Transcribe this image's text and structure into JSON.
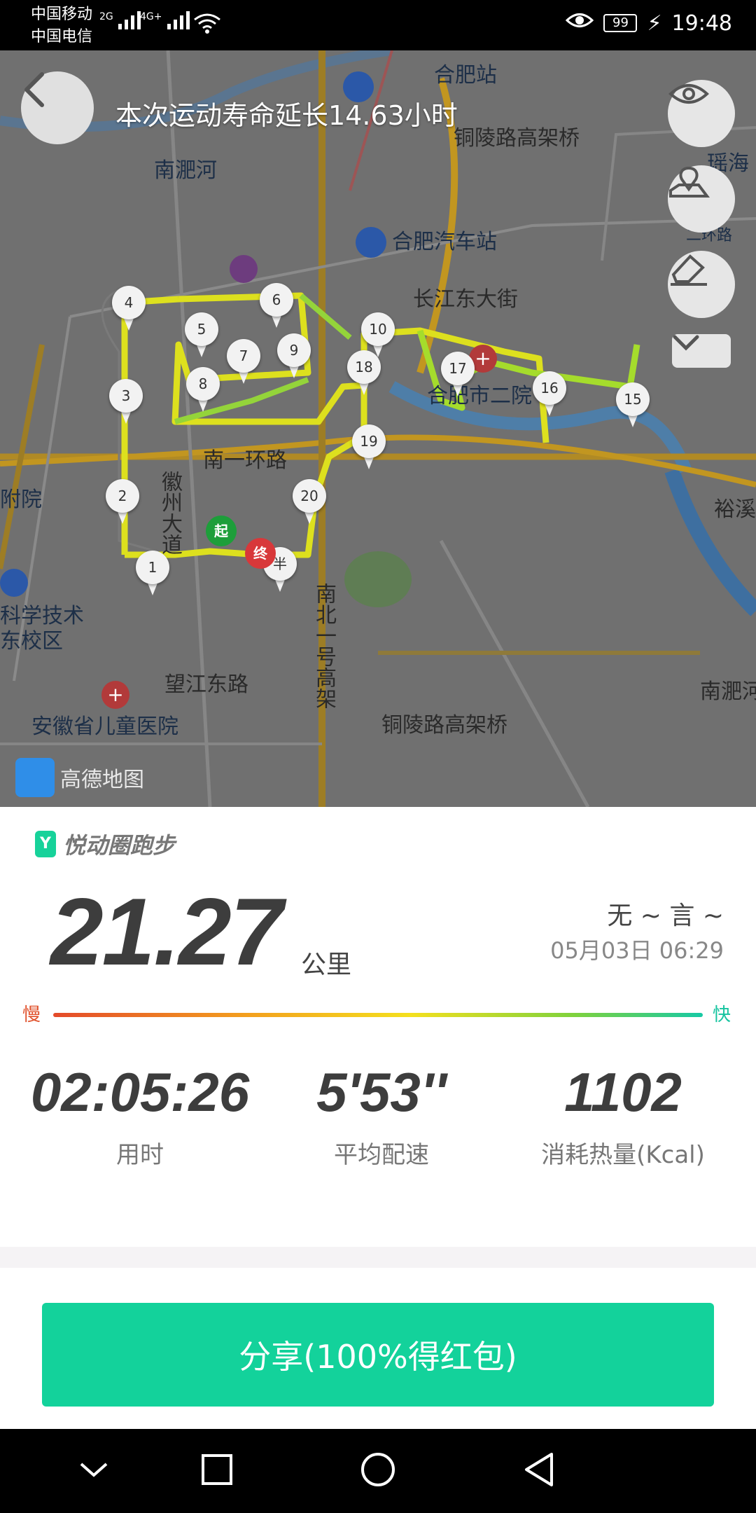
{
  "status_bar": {
    "carrier1": "中国移动",
    "carrier2": "中国电信",
    "net1": "2G",
    "net2": "4G+",
    "battery": "99",
    "time": "19:48"
  },
  "map": {
    "longevity_text": "本次运动寿命延长14.63小时",
    "labels": {
      "hefei_station": "合肥站",
      "tongling_road_viaduct_top": "铜陵路高架桥",
      "nanfei_river": "南淝河",
      "hefei_bus_station": "合肥汽车站",
      "changjiang_east_street": "长江东大街",
      "hefei_second_hospital": "合肥市二院",
      "south_first_ring": "南一环路",
      "huizhou_avenue": "徽州大道",
      "south_north_road": "南北一号高架",
      "wangjiang_east_road": "望江东路",
      "tongling_road_viaduct_bottom": "铜陵路高架桥",
      "anhui_children_hospital": "安徽省儿童医院",
      "university_east_campus": "科学技术\n东校区",
      "hospital_left": "附院",
      "nanfei_river_right": "南淝河",
      "yuxi": "裕溪",
      "yao": "瑶海",
      "erhuan": "二环路"
    },
    "start_label": "起",
    "end_label": "终",
    "half_label": "半",
    "km_markers": [
      "1",
      "2",
      "3",
      "4",
      "5",
      "6",
      "7",
      "8",
      "9",
      "10",
      "17",
      "16",
      "15",
      "18",
      "19",
      "20"
    ],
    "provider": "高德地图"
  },
  "run": {
    "brand": "悦动圈跑步",
    "distance": "21.27",
    "distance_unit": "公里",
    "user_name": "无 ~ 言 ~",
    "datetime": "05月03日 06:29",
    "slow_label": "慢",
    "fast_label": "快",
    "duration": "02:05:26",
    "duration_label": "用时",
    "pace": "5'53''",
    "pace_label": "平均配速",
    "calories": "1102",
    "calories_label": "消耗热量(Kcal)"
  },
  "share": {
    "label": "分享(100%得红包)"
  },
  "colors": {
    "accent": "#13d29b",
    "route_yellow": "#e8e21e",
    "route_green": "#7fd23c",
    "start_marker": "#1d9e3a",
    "end_marker": "#d8383a"
  },
  "icons": {
    "back": "chevron-left-icon",
    "eye": "eye-icon",
    "map_pin": "map-pin-icon",
    "eraser": "eraser-icon",
    "collapse": "chevron-down-icon"
  }
}
